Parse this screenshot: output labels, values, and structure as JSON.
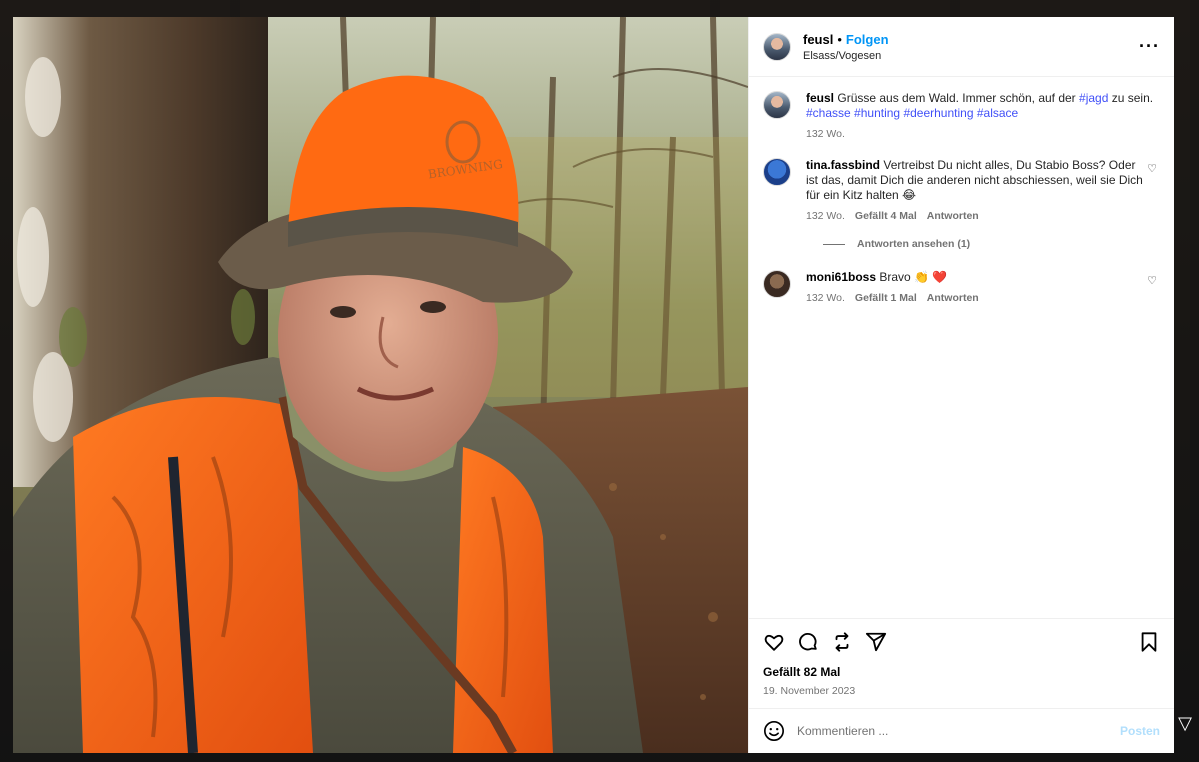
{
  "post": {
    "username": "feusl",
    "separator": "•",
    "follow_label": "Folgen",
    "location": "Elsass/Vogesen",
    "more_icon": "more-horizontal-icon"
  },
  "caption": {
    "username": "feusl",
    "text_before": "Grüsse aus dem Wald. Immer schön, auf der ",
    "tag_inline": "#jagd",
    "text_after": " zu sein.",
    "hashtags": [
      "#chasse",
      "#hunting",
      "#deerhunting",
      "#alsace"
    ],
    "age": "132 Wo."
  },
  "comments": [
    {
      "username": "tina.fassbind",
      "text": "Vertreibst Du nicht alles, Du Stabio Boss? Oder ist das, damit Dich die anderen nicht abschiessen, weil sie Dich für ein Kitz halten 😂",
      "age": "132 Wo.",
      "likes": "Gefällt 4 Mal",
      "reply": "Antworten",
      "view_replies": "Antworten ansehen (1)"
    },
    {
      "username": "moni61boss",
      "text": "Bravo 👏 ❤️",
      "age": "132 Wo.",
      "likes": "Gefällt 1 Mal",
      "reply": "Antworten"
    }
  ],
  "actions": {
    "like_icon": "heart-icon",
    "comment_icon": "comment-icon",
    "repost_icon": "repost-icon",
    "share_icon": "send-icon",
    "save_icon": "bookmark-icon",
    "likes_text": "Gefällt 82 Mal",
    "date": "19. November 2023"
  },
  "comment_input": {
    "placeholder": "Kommentieren ...",
    "post_label": "Posten",
    "emoji_icon": "emoji-icon"
  },
  "colors": {
    "accent": "#0095f6",
    "hashtag": "#4150f7",
    "vest_orange": "#ff6a1a"
  }
}
